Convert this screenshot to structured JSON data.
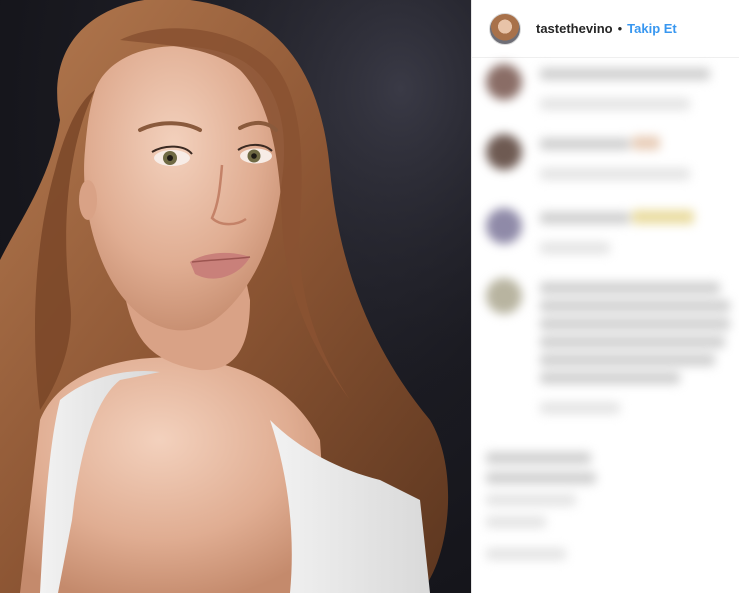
{
  "post": {
    "username": "tastethevino",
    "separator": "•",
    "follow_label": "Takip Et"
  },
  "icons": {
    "avatar": "profile-avatar",
    "comment_avatars": "blurred-avatar"
  },
  "colors": {
    "follow_blue": "#3897f0",
    "username_text": "#262626",
    "panel_background": "#ffffff",
    "photo_background": "#17171d"
  }
}
